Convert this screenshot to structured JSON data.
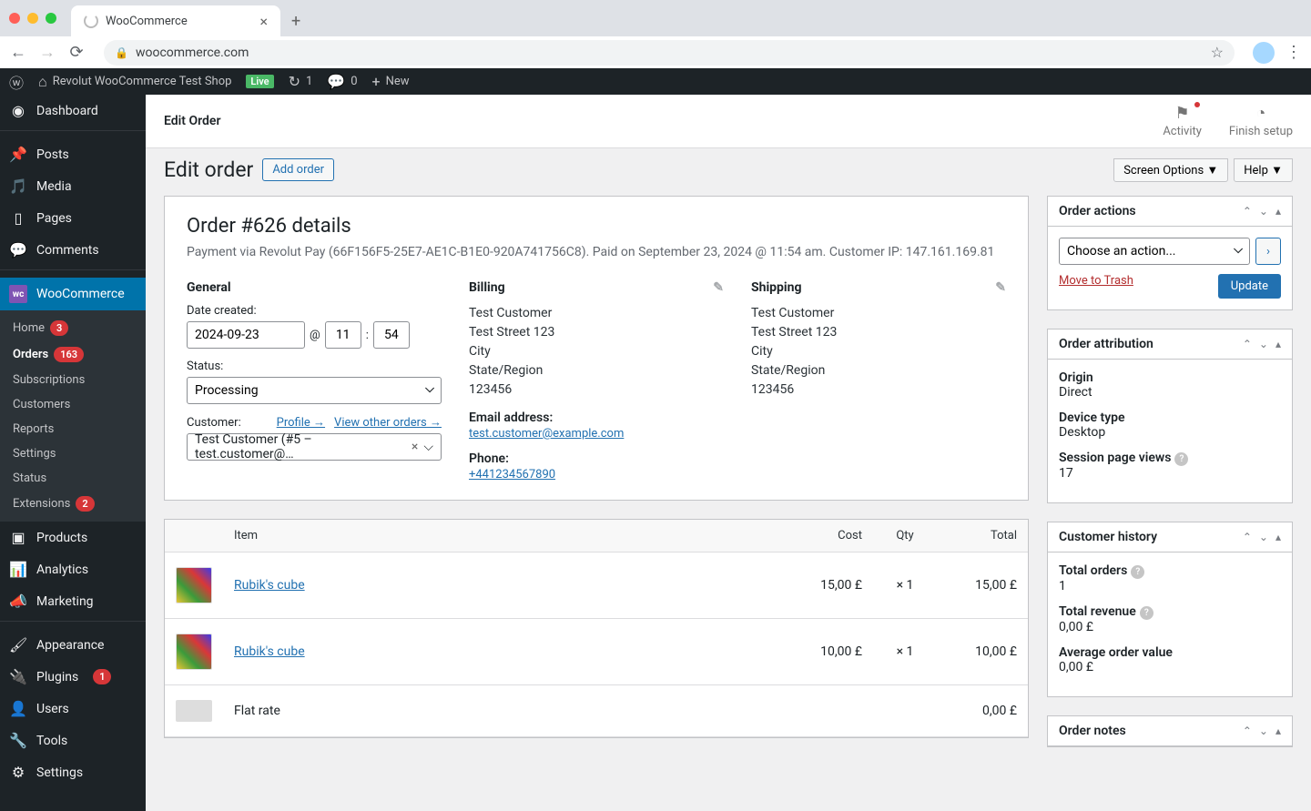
{
  "browser": {
    "tab_title": "WooCommerce",
    "url": "woocommerce.com"
  },
  "admin_bar": {
    "site_name": "Revolut WooCommerce Test Shop",
    "live_badge": "Live",
    "refresh_count": "1",
    "comment_count": "0",
    "new_label": "New"
  },
  "sidebar": {
    "dashboard": "Dashboard",
    "posts": "Posts",
    "media": "Media",
    "pages": "Pages",
    "comments": "Comments",
    "woocommerce": "WooCommerce",
    "submenu": {
      "home": "Home",
      "home_badge": "3",
      "orders": "Orders",
      "orders_badge": "163",
      "subscriptions": "Subscriptions",
      "customers": "Customers",
      "reports": "Reports",
      "coupons": "Settings",
      "status": "Status",
      "extensions": "Extensions",
      "extensions_badge": "2"
    },
    "products": "Products",
    "analytics": "Analytics",
    "marketing": "Marketing",
    "appearance": "Appearance",
    "plugins": "Plugins",
    "plugins_badge": "1",
    "users": "Users",
    "tools": "Tools",
    "settings": "Settings"
  },
  "header": {
    "title": "Edit Order",
    "activity": "Activity",
    "finish_setup": "Finish setup"
  },
  "page": {
    "heading": "Edit order",
    "add_order": "Add order",
    "screen_options": "Screen Options ▼",
    "help": "Help ▼"
  },
  "order": {
    "title": "Order #626 details",
    "meta": "Payment via Revolut Pay (66F156F5-25E7-AE1C-B1E0-920A741756C8). Paid on September 23, 2024 @ 11:54 am. Customer IP: 147.161.169.81",
    "general_label": "General",
    "date_label": "Date created:",
    "date_value": "2024-09-23",
    "at_label": "@",
    "hour": "11",
    "colon": ":",
    "minute": "54",
    "status_label": "Status:",
    "status_value": "Processing",
    "customer_label": "Customer:",
    "profile_link": "Profile →",
    "view_orders_link": "View other orders →",
    "customer_value": "Test Customer (#5 – test.customer@…",
    "billing_label": "Billing",
    "shipping_label": "Shipping",
    "addr_name": "Test Customer",
    "addr_street": "Test Street 123",
    "addr_city": "City",
    "addr_region": "State/Region",
    "addr_zip": "123456",
    "email_label": "Email address:",
    "email_value": "test.customer@example.com",
    "phone_label": "Phone:",
    "phone_value": "+441234567890"
  },
  "items": {
    "th_item": "Item",
    "th_cost": "Cost",
    "th_qty": "Qty",
    "th_total": "Total",
    "rows": [
      {
        "name": "Rubik's cube",
        "cost": "15,00 £",
        "qty": "× 1",
        "total": "15,00 £"
      },
      {
        "name": "Rubik's cube",
        "cost": "10,00 £",
        "qty": "× 1",
        "total": "10,00 £"
      }
    ],
    "shipping_name": "Flat rate",
    "shipping_total": "0,00 £"
  },
  "actions_box": {
    "title": "Order actions",
    "choose": "Choose an action...",
    "trash": "Move to Trash",
    "update": "Update"
  },
  "attribution_box": {
    "title": "Order attribution",
    "origin_label": "Origin",
    "origin_value": "Direct",
    "device_label": "Device type",
    "device_value": "Desktop",
    "views_label": "Session page views",
    "views_value": "17"
  },
  "history_box": {
    "title": "Customer history",
    "total_orders_label": "Total orders",
    "total_orders_value": "1",
    "total_revenue_label": "Total revenue",
    "total_revenue_value": "0,00 £",
    "avg_label": "Average order value",
    "avg_value": "0,00 £"
  },
  "notes_box": {
    "title": "Order notes"
  }
}
